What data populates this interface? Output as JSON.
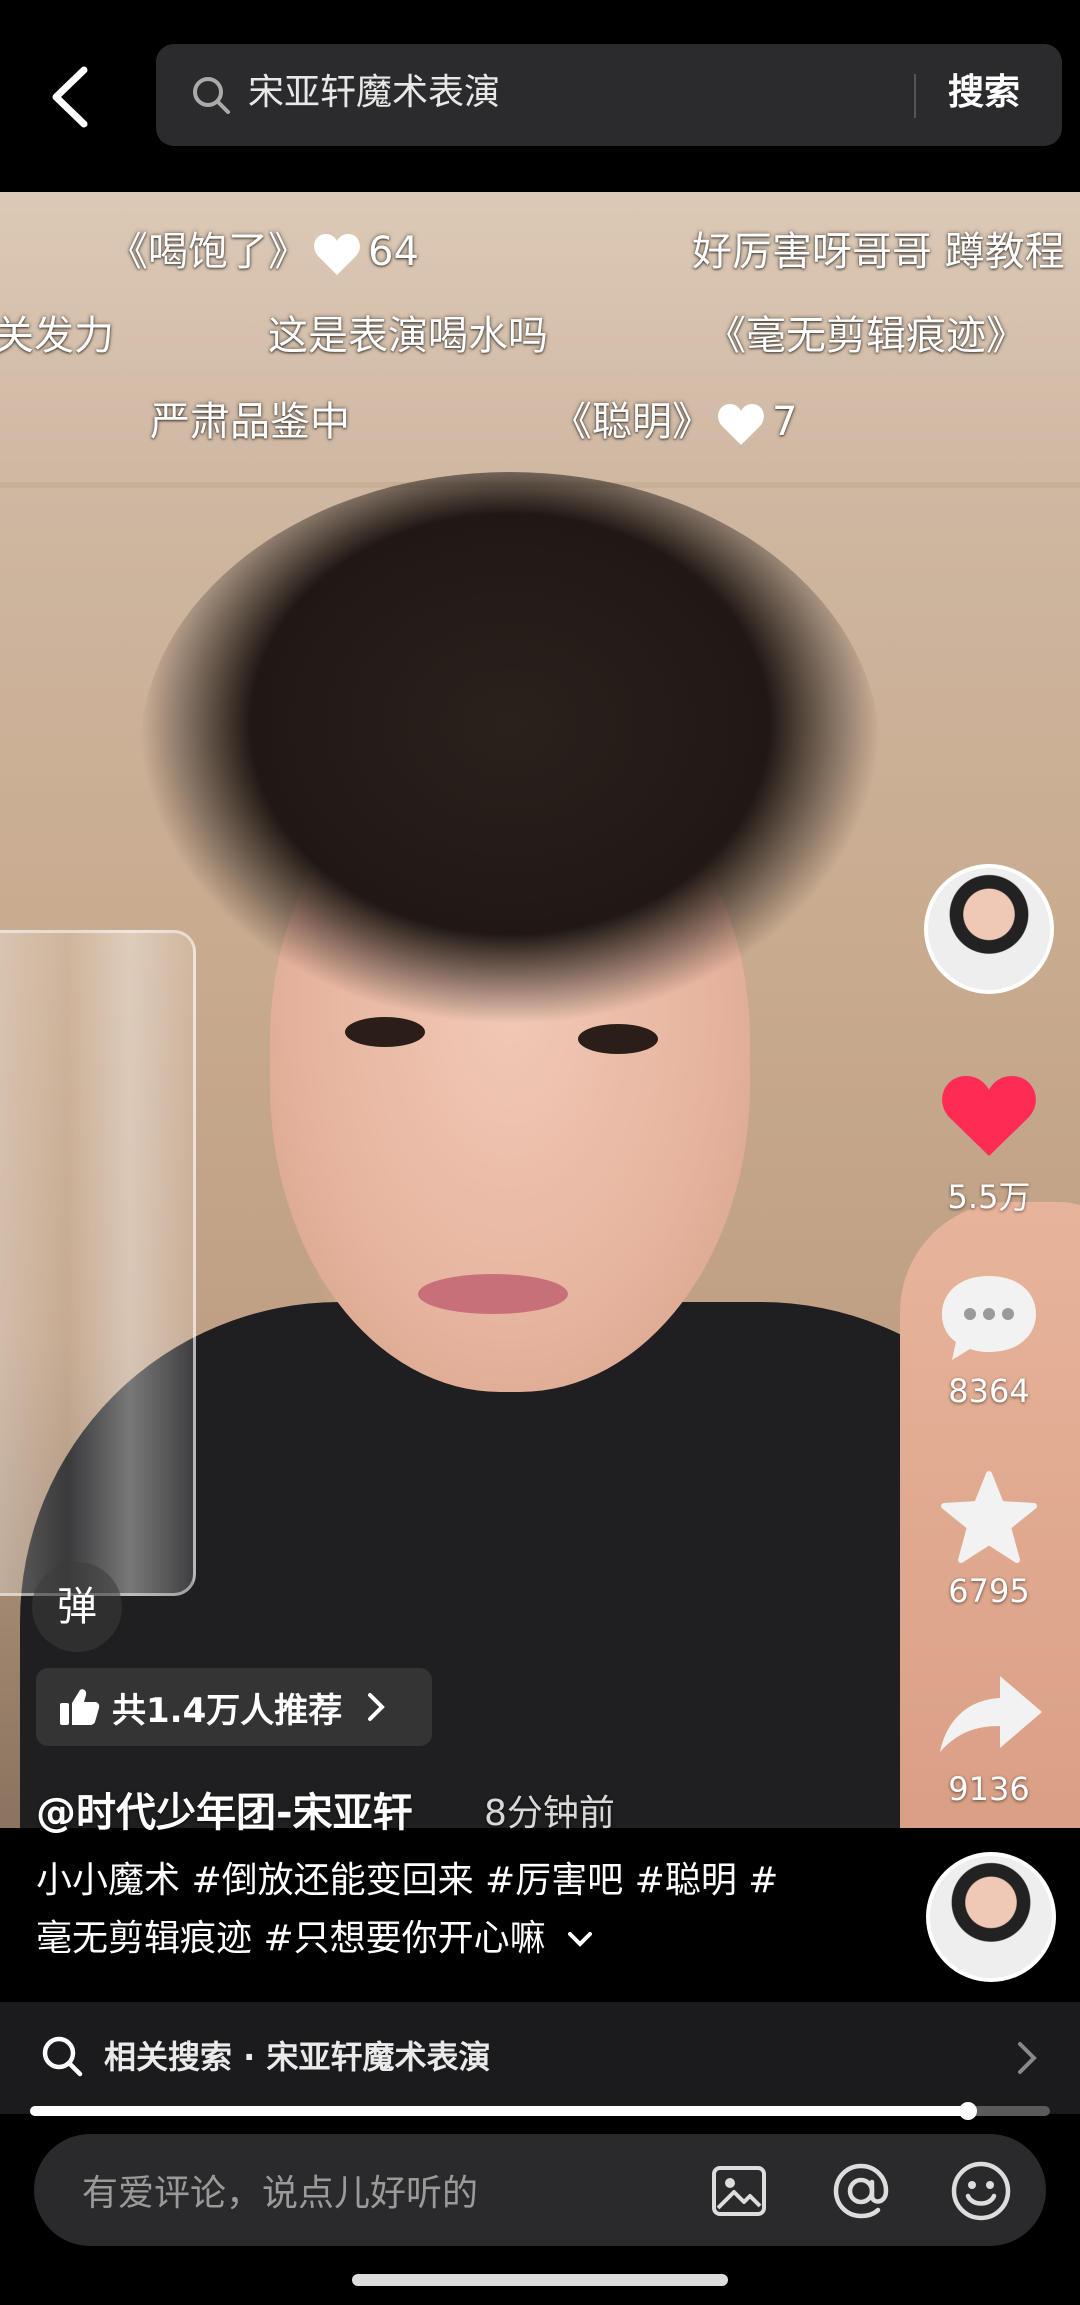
{
  "search": {
    "query": "宋亚轩魔术表演",
    "button_label": "搜索"
  },
  "danmaku": [
    {
      "text": "《喝饱了》",
      "likes": "64",
      "has_heart": true
    },
    {
      "text": "好厉害呀哥哥 蹲教程",
      "has_heart": false
    },
    {
      "text": "关发力",
      "has_heart": false
    },
    {
      "text": "这是表演喝水吗",
      "has_heart": false
    },
    {
      "text": "《毫无剪辑痕迹》",
      "has_heart": false
    },
    {
      "text": "严肃品鉴中",
      "has_heart": false
    },
    {
      "text": "《聪明》",
      "likes": "7",
      "has_heart": true
    }
  ],
  "actions": {
    "likes": "5.5万",
    "comments": "8364",
    "favorites": "6795",
    "shares": "9136"
  },
  "danmaku_toggle": "弹",
  "recommend": "共1.4万人推荐",
  "author": "@时代少年团-宋亚轩",
  "time": "8分钟前",
  "caption_line1": "小小魔术 #倒放还能变回来 #厉害吧 #聪明 #",
  "caption_line2": "毫无剪辑痕迹 #只想要你开心嘛",
  "related_search": "相关搜索 · 宋亚轩魔术表演",
  "progress": 0.92,
  "comment_placeholder": "有爱评论，说点儿好听的",
  "colors": {
    "like_red": "#fe2c55"
  }
}
